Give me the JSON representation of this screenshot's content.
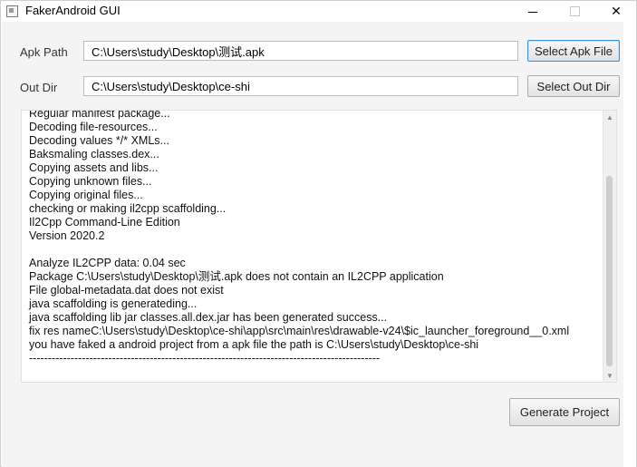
{
  "window": {
    "title": "FakerAndroid GUI",
    "minimize_glyph": "",
    "close_glyph": "✕"
  },
  "form": {
    "apk_label": "Apk Path",
    "apk_value": "C:\\Users\\study\\Desktop\\测试.apk",
    "apk_button": "Select Apk File",
    "out_label": "Out Dir",
    "out_value": "C:\\Users\\study\\Desktop\\ce-shi",
    "out_button": "Select Out Dir"
  },
  "log": {
    "lines": [
      "Regular manifest package...",
      "Decoding file-resources...",
      "Decoding values */* XMLs...",
      "Baksmaling classes.dex...",
      "Copying assets and libs...",
      "Copying unknown files...",
      "Copying original files...",
      "checking or making il2cpp scaffolding...",
      "Il2Cpp Command-Line Edition",
      "Version 2020.2",
      "",
      "Analyze IL2CPP data: 0.04 sec",
      "Package C:\\Users\\study\\Desktop\\测试.apk does not contain an IL2CPP application",
      "File global-metadata.dat does not exist",
      "java scaffolding is generateding...",
      "java scaffolding lib jar classes.all.dex.jar has been generated success...",
      "fix res nameC:\\Users\\study\\Desktop\\ce-shi\\app\\src\\main\\res\\drawable-v24\\$ic_launcher_foreground__0.xml",
      "you have faked a android project from a apk file the path is C:\\Users\\study\\Desktop\\ce-shi",
      "---------------------------------------------------------------------------------------------"
    ],
    "scroll_up_glyph": "▲",
    "scroll_down_glyph": "▼"
  },
  "actions": {
    "generate_button": "Generate Project"
  }
}
